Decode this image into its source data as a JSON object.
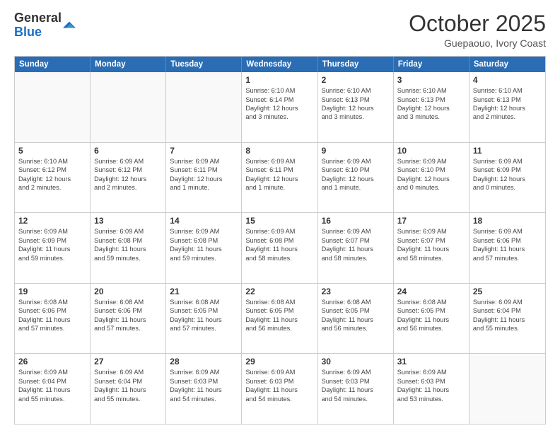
{
  "header": {
    "logo_general": "General",
    "logo_blue": "Blue",
    "month_title": "October 2025",
    "subtitle": "Guepaouo, Ivory Coast"
  },
  "days_of_week": [
    "Sunday",
    "Monday",
    "Tuesday",
    "Wednesday",
    "Thursday",
    "Friday",
    "Saturday"
  ],
  "weeks": [
    [
      {
        "day": "",
        "text": ""
      },
      {
        "day": "",
        "text": ""
      },
      {
        "day": "",
        "text": ""
      },
      {
        "day": "1",
        "text": "Sunrise: 6:10 AM\nSunset: 6:14 PM\nDaylight: 12 hours\nand 3 minutes."
      },
      {
        "day": "2",
        "text": "Sunrise: 6:10 AM\nSunset: 6:13 PM\nDaylight: 12 hours\nand 3 minutes."
      },
      {
        "day": "3",
        "text": "Sunrise: 6:10 AM\nSunset: 6:13 PM\nDaylight: 12 hours\nand 3 minutes."
      },
      {
        "day": "4",
        "text": "Sunrise: 6:10 AM\nSunset: 6:13 PM\nDaylight: 12 hours\nand 2 minutes."
      }
    ],
    [
      {
        "day": "5",
        "text": "Sunrise: 6:10 AM\nSunset: 6:12 PM\nDaylight: 12 hours\nand 2 minutes."
      },
      {
        "day": "6",
        "text": "Sunrise: 6:09 AM\nSunset: 6:12 PM\nDaylight: 12 hours\nand 2 minutes."
      },
      {
        "day": "7",
        "text": "Sunrise: 6:09 AM\nSunset: 6:11 PM\nDaylight: 12 hours\nand 1 minute."
      },
      {
        "day": "8",
        "text": "Sunrise: 6:09 AM\nSunset: 6:11 PM\nDaylight: 12 hours\nand 1 minute."
      },
      {
        "day": "9",
        "text": "Sunrise: 6:09 AM\nSunset: 6:10 PM\nDaylight: 12 hours\nand 1 minute."
      },
      {
        "day": "10",
        "text": "Sunrise: 6:09 AM\nSunset: 6:10 PM\nDaylight: 12 hours\nand 0 minutes."
      },
      {
        "day": "11",
        "text": "Sunrise: 6:09 AM\nSunset: 6:09 PM\nDaylight: 12 hours\nand 0 minutes."
      }
    ],
    [
      {
        "day": "12",
        "text": "Sunrise: 6:09 AM\nSunset: 6:09 PM\nDaylight: 11 hours\nand 59 minutes."
      },
      {
        "day": "13",
        "text": "Sunrise: 6:09 AM\nSunset: 6:08 PM\nDaylight: 11 hours\nand 59 minutes."
      },
      {
        "day": "14",
        "text": "Sunrise: 6:09 AM\nSunset: 6:08 PM\nDaylight: 11 hours\nand 59 minutes."
      },
      {
        "day": "15",
        "text": "Sunrise: 6:09 AM\nSunset: 6:08 PM\nDaylight: 11 hours\nand 58 minutes."
      },
      {
        "day": "16",
        "text": "Sunrise: 6:09 AM\nSunset: 6:07 PM\nDaylight: 11 hours\nand 58 minutes."
      },
      {
        "day": "17",
        "text": "Sunrise: 6:09 AM\nSunset: 6:07 PM\nDaylight: 11 hours\nand 58 minutes."
      },
      {
        "day": "18",
        "text": "Sunrise: 6:09 AM\nSunset: 6:06 PM\nDaylight: 11 hours\nand 57 minutes."
      }
    ],
    [
      {
        "day": "19",
        "text": "Sunrise: 6:08 AM\nSunset: 6:06 PM\nDaylight: 11 hours\nand 57 minutes."
      },
      {
        "day": "20",
        "text": "Sunrise: 6:08 AM\nSunset: 6:06 PM\nDaylight: 11 hours\nand 57 minutes."
      },
      {
        "day": "21",
        "text": "Sunrise: 6:08 AM\nSunset: 6:05 PM\nDaylight: 11 hours\nand 57 minutes."
      },
      {
        "day": "22",
        "text": "Sunrise: 6:08 AM\nSunset: 6:05 PM\nDaylight: 11 hours\nand 56 minutes."
      },
      {
        "day": "23",
        "text": "Sunrise: 6:08 AM\nSunset: 6:05 PM\nDaylight: 11 hours\nand 56 minutes."
      },
      {
        "day": "24",
        "text": "Sunrise: 6:08 AM\nSunset: 6:05 PM\nDaylight: 11 hours\nand 56 minutes."
      },
      {
        "day": "25",
        "text": "Sunrise: 6:09 AM\nSunset: 6:04 PM\nDaylight: 11 hours\nand 55 minutes."
      }
    ],
    [
      {
        "day": "26",
        "text": "Sunrise: 6:09 AM\nSunset: 6:04 PM\nDaylight: 11 hours\nand 55 minutes."
      },
      {
        "day": "27",
        "text": "Sunrise: 6:09 AM\nSunset: 6:04 PM\nDaylight: 11 hours\nand 55 minutes."
      },
      {
        "day": "28",
        "text": "Sunrise: 6:09 AM\nSunset: 6:03 PM\nDaylight: 11 hours\nand 54 minutes."
      },
      {
        "day": "29",
        "text": "Sunrise: 6:09 AM\nSunset: 6:03 PM\nDaylight: 11 hours\nand 54 minutes."
      },
      {
        "day": "30",
        "text": "Sunrise: 6:09 AM\nSunset: 6:03 PM\nDaylight: 11 hours\nand 54 minutes."
      },
      {
        "day": "31",
        "text": "Sunrise: 6:09 AM\nSunset: 6:03 PM\nDaylight: 11 hours\nand 53 minutes."
      },
      {
        "day": "",
        "text": ""
      }
    ]
  ]
}
